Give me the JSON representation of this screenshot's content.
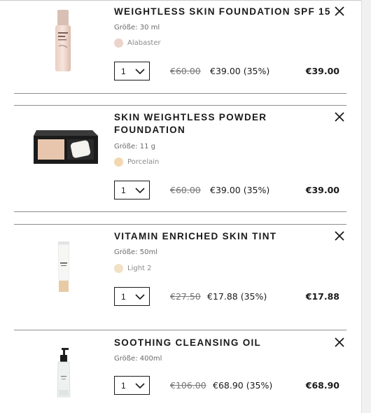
{
  "items": [
    {
      "title": "WEIGHTLESS SKIN FOUNDATION SPF 15",
      "size": "Größe: 30 ml",
      "shade": "Alabaster",
      "shade_color": "#ecd3cb",
      "qty": "1",
      "old_price": "€60.00",
      "new_price": "€39.00 (35%)",
      "total": "€39.00",
      "image": "foundation-bottle"
    },
    {
      "title_line1": "SKIN WEIGHTLESS POWDER",
      "title_line2": "FOUNDATION",
      "size": "Größe: 11 g",
      "shade": "Porcelain",
      "shade_color": "#f1d8b0",
      "qty": "1",
      "old_price": "€60.00",
      "new_price": "€39.00 (35%)",
      "total": "€39.00",
      "image": "powder-compact"
    },
    {
      "title": "VITAMIN ENRICHED SKIN TINT",
      "size": "Größe: 50ml",
      "shade": "Light 2",
      "shade_color": "#f1e1c6",
      "qty": "1",
      "old_price": "€27.50",
      "new_price": "€17.88 (35%)",
      "total": "€17.88",
      "image": "skin-tint-tube"
    },
    {
      "title": "SOOTHING CLEANSING OIL",
      "size": "Größe: 400ml",
      "qty": "1",
      "old_price": "€106.00",
      "new_price": "€68.90 (35%)",
      "total": "€68.90",
      "image": "cleansing-oil-pump-bottle"
    }
  ]
}
